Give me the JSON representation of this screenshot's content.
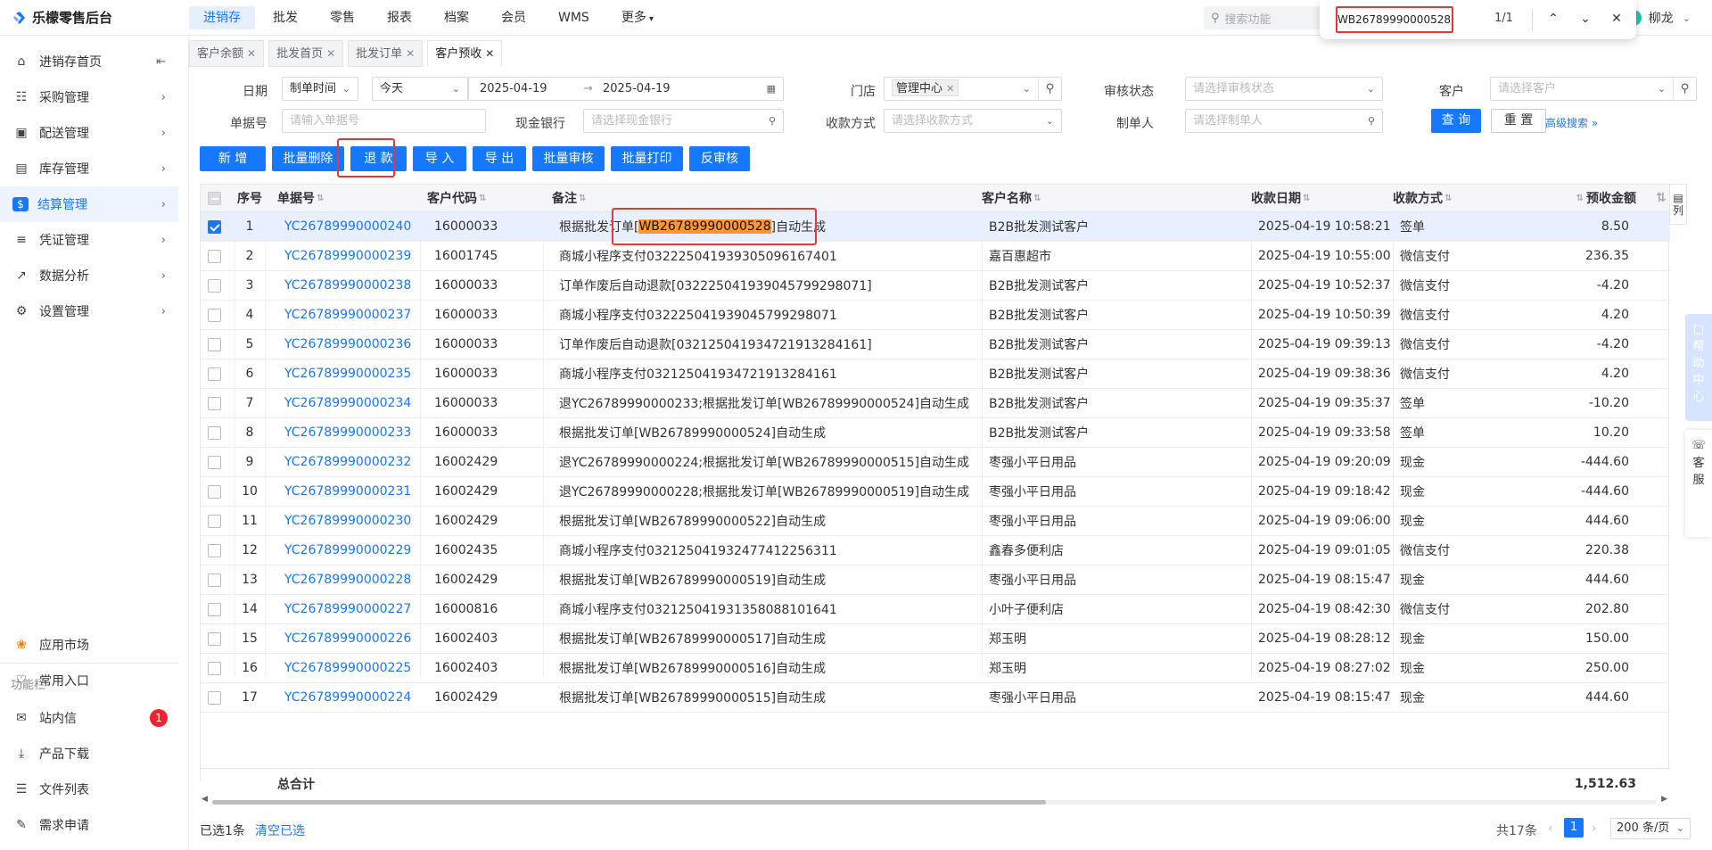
{
  "app": {
    "name": "乐檬零售后台"
  },
  "topnav": {
    "items": [
      "进销存",
      "批发",
      "零售",
      "报表",
      "档案",
      "会员",
      "WMS",
      "更多"
    ],
    "active": 0
  },
  "search_func": {
    "placeholder": "搜索功能"
  },
  "user": {
    "name": "柳龙"
  },
  "findbar": {
    "query": "WB26789990000528",
    "count": "1/1"
  },
  "sidebar": {
    "items": [
      "进销存首页",
      "采购管理",
      "配送管理",
      "库存管理",
      "结算管理",
      "凭证管理",
      "数据分析",
      "设置管理"
    ],
    "active": 4,
    "apps": [
      "应用市场",
      "常用入口"
    ],
    "section_title": "功能栏",
    "func_items": [
      "站内信",
      "产品下载",
      "文件列表",
      "需求申请"
    ],
    "badge": "1"
  },
  "tabs": [
    "客户余额",
    "批发首页",
    "批发订单",
    "客户预收"
  ],
  "active_tab": 3,
  "filters": {
    "date_label": "日期",
    "date_type": "制单时间",
    "date_range": "今天",
    "date_start": "2025-04-19",
    "date_end": "2025-04-19",
    "store_label": "门店",
    "store_tag": "管理中心",
    "audit_label": "审核状态",
    "audit_ph": "请选择审核状态",
    "customer_label": "客户",
    "customer_ph": "请选择客户",
    "doc_label": "单据号",
    "doc_ph": "请输入单据号",
    "bank_label": "现金银行",
    "bank_ph": "请选择现金银行",
    "pay_label": "收款方式",
    "pay_ph": "请选择收款方式",
    "maker_label": "制单人",
    "maker_ph": "请选择制单人",
    "query_btn": "查 询",
    "reset_btn": "重 置",
    "advanced": "高级搜索"
  },
  "toolbar": [
    "新 增",
    "批量删除",
    "退 款",
    "导 入",
    "导 出",
    "批量审核",
    "批量打印",
    "反审核"
  ],
  "table": {
    "headers": [
      "序号",
      "单据号",
      "客户代码",
      "备注",
      "客户名称",
      "收款日期",
      "收款方式",
      "预收金额"
    ],
    "rows": [
      {
        "no": "1",
        "doc": "YC26789990000240",
        "code": "16000033",
        "memo": "根据批发订单[WB26789990000528]自动生成",
        "name": "B2B批发测试客户",
        "date": "2025-04-19 10:58:21",
        "pay": "签单",
        "amount": "8.50",
        "selected": true
      },
      {
        "no": "2",
        "doc": "YC26789990000239",
        "code": "16001745",
        "memo": "商城小程序支付03222504193930509616740​1",
        "name": "嘉百惠超市",
        "date": "2025-04-19 10:55:00",
        "pay": "微信支付",
        "amount": "236.35"
      },
      {
        "no": "3",
        "doc": "YC26789990000238",
        "code": "16000033",
        "memo": "订单作废后自动退款[03222504193904579929807​1]",
        "name": "B2B批发测试客户",
        "date": "2025-04-19 10:52:37",
        "pay": "微信支付",
        "amount": "-4.20"
      },
      {
        "no": "4",
        "doc": "YC26789990000237",
        "code": "16000033",
        "memo": "商城小程序支付03222504193904579929807​1",
        "name": "B2B批发测试客户",
        "date": "2025-04-19 10:50:39",
        "pay": "微信支付",
        "amount": "4.20"
      },
      {
        "no": "5",
        "doc": "YC26789990000236",
        "code": "16000033",
        "memo": "订单作废后自动退款[032125041934721913284161]",
        "name": "B2B批发测试客户",
        "date": "2025-04-19 09:39:13",
        "pay": "微信支付",
        "amount": "-4.20"
      },
      {
        "no": "6",
        "doc": "YC26789990000235",
        "code": "16000033",
        "memo": "商城小程序支付032125041934721913284161",
        "name": "B2B批发测试客户",
        "date": "2025-04-19 09:38:36",
        "pay": "微信支付",
        "amount": "4.20"
      },
      {
        "no": "7",
        "doc": "YC26789990000234",
        "code": "16000033",
        "memo": "退YC26789990000233;根据批发订单[WB26789990000524]自动生成",
        "name": "B2B批发测试客户",
        "date": "2025-04-19 09:35:37",
        "pay": "签单",
        "amount": "-10.20"
      },
      {
        "no": "8",
        "doc": "YC26789990000233",
        "code": "16000033",
        "memo": "根据批发订单[WB26789990000524]自动生成",
        "name": "B2B批发测试客户",
        "date": "2025-04-19 09:33:58",
        "pay": "签单",
        "amount": "10.20"
      },
      {
        "no": "9",
        "doc": "YC26789990000232",
        "code": "16002429",
        "memo": "退YC26789990000224;根据批发订单[WB26789990000515]自动生成",
        "name": "枣强小平日用品",
        "date": "2025-04-19 09:20:09",
        "pay": "现金",
        "amount": "-444.60"
      },
      {
        "no": "10",
        "doc": "YC26789990000231",
        "code": "16002429",
        "memo": "退YC26789990000228;根据批发订单[WB26789990000519]自动生成",
        "name": "枣强小平日用品",
        "date": "2025-04-19 09:18:42",
        "pay": "现金",
        "amount": "-444.60"
      },
      {
        "no": "11",
        "doc": "YC26789990000230",
        "code": "16002429",
        "memo": "根据批发订单[WB26789990000522]自动生成",
        "name": "枣强小平日用品",
        "date": "2025-04-19 09:06:00",
        "pay": "现金",
        "amount": "444.60"
      },
      {
        "no": "12",
        "doc": "YC26789990000229",
        "code": "16002435",
        "memo": "商城小程序支付032125041932477412256311",
        "name": "鑫春多便利店",
        "date": "2025-04-19 09:01:05",
        "pay": "微信支付",
        "amount": "220.38"
      },
      {
        "no": "13",
        "doc": "YC26789990000228",
        "code": "16002429",
        "memo": "根据批发订单[WB26789990000519]自动生成",
        "name": "枣强小平日用品",
        "date": "2025-04-19 08:15:47",
        "pay": "现金",
        "amount": "444.60"
      },
      {
        "no": "14",
        "doc": "YC26789990000227",
        "code": "16000816",
        "memo": "商城小程序支付032125041931358088101641",
        "name": "小叶子便利店",
        "date": "2025-04-19 08:42:30",
        "pay": "微信支付",
        "amount": "202.80"
      },
      {
        "no": "15",
        "doc": "YC26789990000226",
        "code": "16002403",
        "memo": "根据批发订单[WB26789990000517]自动生成",
        "name": "郑玉明",
        "date": "2025-04-19 08:28:12",
        "pay": "现金",
        "amount": "150.00"
      },
      {
        "no": "16",
        "doc": "YC26789990000225",
        "code": "16002403",
        "memo": "根据批发订单[WB26789990000516]自动生成",
        "name": "郑玉明",
        "date": "2025-04-19 08:27:02",
        "pay": "现金",
        "amount": "250.00"
      },
      {
        "no": "17",
        "doc": "YC26789990000224",
        "code": "16002429",
        "memo": "根据批发订单[WB26789990000515]自动生成",
        "name": "枣强小平日用品",
        "date": "2025-04-19 08:15:47",
        "pay": "现金",
        "amount": "444.60"
      }
    ],
    "total_label": "总合计",
    "total_amount": "1,512.63"
  },
  "footer": {
    "selected": "已选1条",
    "clear": "清空已选",
    "total": "共17条",
    "page": "1",
    "page_size": "200 条/页"
  },
  "floating": {
    "column_btn": "列",
    "help": "帮助中心",
    "service": "客服"
  },
  "colors": {
    "primary": "#1677ff",
    "highlight": "#ff9632",
    "annotation": "#e53935"
  }
}
